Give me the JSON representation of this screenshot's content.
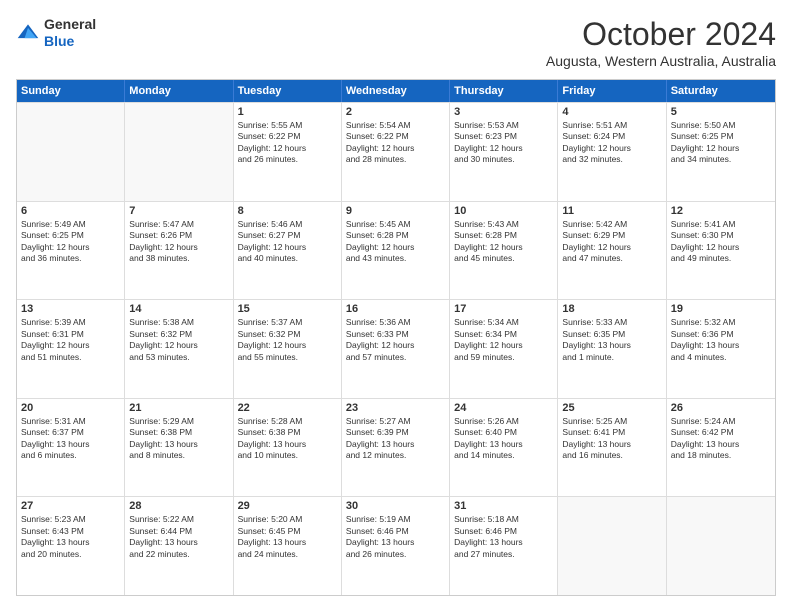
{
  "logo": {
    "line1": "General",
    "line2": "Blue"
  },
  "header": {
    "title": "October 2024",
    "location": "Augusta, Western Australia, Australia"
  },
  "weekdays": [
    "Sunday",
    "Monday",
    "Tuesday",
    "Wednesday",
    "Thursday",
    "Friday",
    "Saturday"
  ],
  "rows": [
    [
      {
        "day": "",
        "lines": []
      },
      {
        "day": "",
        "lines": []
      },
      {
        "day": "1",
        "lines": [
          "Sunrise: 5:55 AM",
          "Sunset: 6:22 PM",
          "Daylight: 12 hours",
          "and 26 minutes."
        ]
      },
      {
        "day": "2",
        "lines": [
          "Sunrise: 5:54 AM",
          "Sunset: 6:22 PM",
          "Daylight: 12 hours",
          "and 28 minutes."
        ]
      },
      {
        "day": "3",
        "lines": [
          "Sunrise: 5:53 AM",
          "Sunset: 6:23 PM",
          "Daylight: 12 hours",
          "and 30 minutes."
        ]
      },
      {
        "day": "4",
        "lines": [
          "Sunrise: 5:51 AM",
          "Sunset: 6:24 PM",
          "Daylight: 12 hours",
          "and 32 minutes."
        ]
      },
      {
        "day": "5",
        "lines": [
          "Sunrise: 5:50 AM",
          "Sunset: 6:25 PM",
          "Daylight: 12 hours",
          "and 34 minutes."
        ]
      }
    ],
    [
      {
        "day": "6",
        "lines": [
          "Sunrise: 5:49 AM",
          "Sunset: 6:25 PM",
          "Daylight: 12 hours",
          "and 36 minutes."
        ]
      },
      {
        "day": "7",
        "lines": [
          "Sunrise: 5:47 AM",
          "Sunset: 6:26 PM",
          "Daylight: 12 hours",
          "and 38 minutes."
        ]
      },
      {
        "day": "8",
        "lines": [
          "Sunrise: 5:46 AM",
          "Sunset: 6:27 PM",
          "Daylight: 12 hours",
          "and 40 minutes."
        ]
      },
      {
        "day": "9",
        "lines": [
          "Sunrise: 5:45 AM",
          "Sunset: 6:28 PM",
          "Daylight: 12 hours",
          "and 43 minutes."
        ]
      },
      {
        "day": "10",
        "lines": [
          "Sunrise: 5:43 AM",
          "Sunset: 6:28 PM",
          "Daylight: 12 hours",
          "and 45 minutes."
        ]
      },
      {
        "day": "11",
        "lines": [
          "Sunrise: 5:42 AM",
          "Sunset: 6:29 PM",
          "Daylight: 12 hours",
          "and 47 minutes."
        ]
      },
      {
        "day": "12",
        "lines": [
          "Sunrise: 5:41 AM",
          "Sunset: 6:30 PM",
          "Daylight: 12 hours",
          "and 49 minutes."
        ]
      }
    ],
    [
      {
        "day": "13",
        "lines": [
          "Sunrise: 5:39 AM",
          "Sunset: 6:31 PM",
          "Daylight: 12 hours",
          "and 51 minutes."
        ]
      },
      {
        "day": "14",
        "lines": [
          "Sunrise: 5:38 AM",
          "Sunset: 6:32 PM",
          "Daylight: 12 hours",
          "and 53 minutes."
        ]
      },
      {
        "day": "15",
        "lines": [
          "Sunrise: 5:37 AM",
          "Sunset: 6:32 PM",
          "Daylight: 12 hours",
          "and 55 minutes."
        ]
      },
      {
        "day": "16",
        "lines": [
          "Sunrise: 5:36 AM",
          "Sunset: 6:33 PM",
          "Daylight: 12 hours",
          "and 57 minutes."
        ]
      },
      {
        "day": "17",
        "lines": [
          "Sunrise: 5:34 AM",
          "Sunset: 6:34 PM",
          "Daylight: 12 hours",
          "and 59 minutes."
        ]
      },
      {
        "day": "18",
        "lines": [
          "Sunrise: 5:33 AM",
          "Sunset: 6:35 PM",
          "Daylight: 13 hours",
          "and 1 minute."
        ]
      },
      {
        "day": "19",
        "lines": [
          "Sunrise: 5:32 AM",
          "Sunset: 6:36 PM",
          "Daylight: 13 hours",
          "and 4 minutes."
        ]
      }
    ],
    [
      {
        "day": "20",
        "lines": [
          "Sunrise: 5:31 AM",
          "Sunset: 6:37 PM",
          "Daylight: 13 hours",
          "and 6 minutes."
        ]
      },
      {
        "day": "21",
        "lines": [
          "Sunrise: 5:29 AM",
          "Sunset: 6:38 PM",
          "Daylight: 13 hours",
          "and 8 minutes."
        ]
      },
      {
        "day": "22",
        "lines": [
          "Sunrise: 5:28 AM",
          "Sunset: 6:38 PM",
          "Daylight: 13 hours",
          "and 10 minutes."
        ]
      },
      {
        "day": "23",
        "lines": [
          "Sunrise: 5:27 AM",
          "Sunset: 6:39 PM",
          "Daylight: 13 hours",
          "and 12 minutes."
        ]
      },
      {
        "day": "24",
        "lines": [
          "Sunrise: 5:26 AM",
          "Sunset: 6:40 PM",
          "Daylight: 13 hours",
          "and 14 minutes."
        ]
      },
      {
        "day": "25",
        "lines": [
          "Sunrise: 5:25 AM",
          "Sunset: 6:41 PM",
          "Daylight: 13 hours",
          "and 16 minutes."
        ]
      },
      {
        "day": "26",
        "lines": [
          "Sunrise: 5:24 AM",
          "Sunset: 6:42 PM",
          "Daylight: 13 hours",
          "and 18 minutes."
        ]
      }
    ],
    [
      {
        "day": "27",
        "lines": [
          "Sunrise: 5:23 AM",
          "Sunset: 6:43 PM",
          "Daylight: 13 hours",
          "and 20 minutes."
        ]
      },
      {
        "day": "28",
        "lines": [
          "Sunrise: 5:22 AM",
          "Sunset: 6:44 PM",
          "Daylight: 13 hours",
          "and 22 minutes."
        ]
      },
      {
        "day": "29",
        "lines": [
          "Sunrise: 5:20 AM",
          "Sunset: 6:45 PM",
          "Daylight: 13 hours",
          "and 24 minutes."
        ]
      },
      {
        "day": "30",
        "lines": [
          "Sunrise: 5:19 AM",
          "Sunset: 6:46 PM",
          "Daylight: 13 hours",
          "and 26 minutes."
        ]
      },
      {
        "day": "31",
        "lines": [
          "Sunrise: 5:18 AM",
          "Sunset: 6:46 PM",
          "Daylight: 13 hours",
          "and 27 minutes."
        ]
      },
      {
        "day": "",
        "lines": []
      },
      {
        "day": "",
        "lines": []
      }
    ]
  ]
}
